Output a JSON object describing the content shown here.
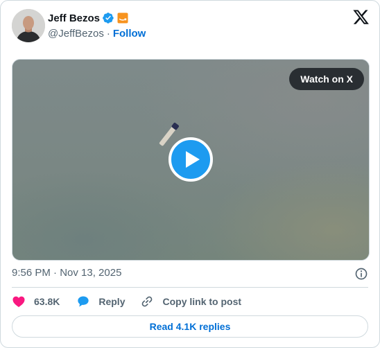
{
  "author": {
    "name": "Jeff Bezos",
    "handle": "@JeffBezos",
    "separator": "·",
    "follow_label": "Follow",
    "verified_icon": "verified-badge-icon",
    "affiliation_icon": "amazon-affiliate-badge-icon"
  },
  "brand_icon": "x-logo-icon",
  "media": {
    "watch_label": "Watch on X",
    "play_icon": "play-icon"
  },
  "timestamp": "9:56 PM · Nov 13, 2025",
  "info_icon": "info-icon",
  "actions": {
    "like_icon": "heart-icon",
    "like_count": "63.8K",
    "reply_icon": "reply-bubble-icon",
    "reply_label": "Reply",
    "copy_icon": "link-icon",
    "copy_label": "Copy link to post"
  },
  "read_replies_label": "Read 4.1K replies",
  "colors": {
    "accent": "#1d9bf0",
    "link": "#006fd6",
    "like": "#f91880",
    "muted": "#536471",
    "border": "#cfd9de"
  }
}
